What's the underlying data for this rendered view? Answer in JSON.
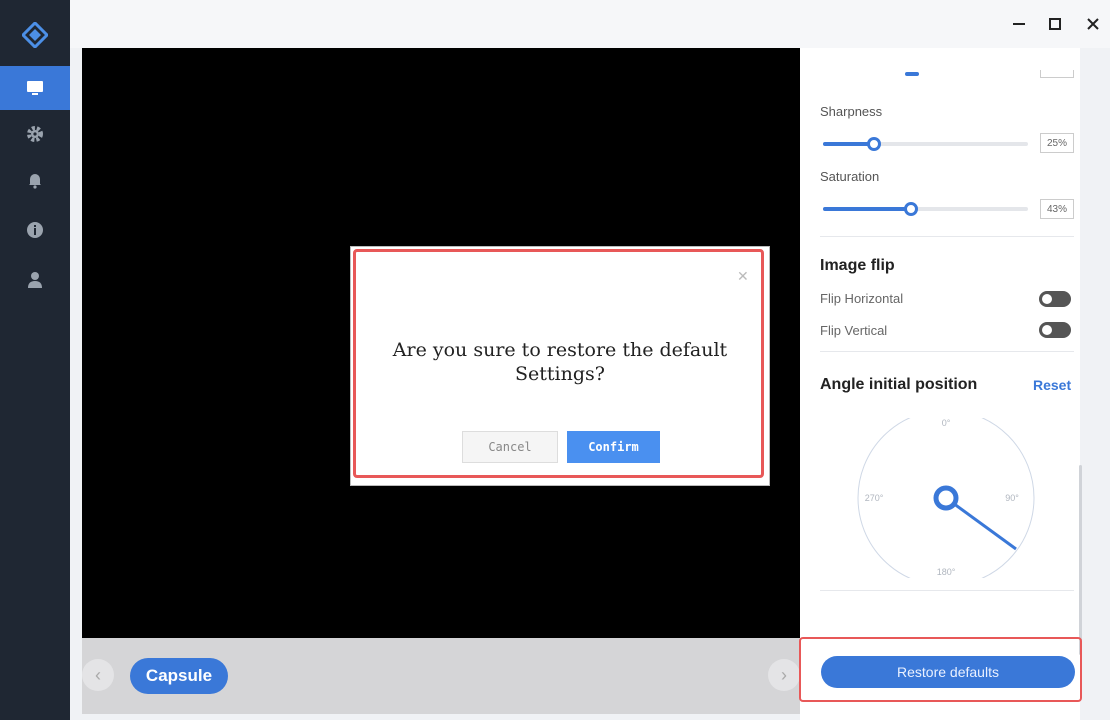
{
  "sidebar": {
    "logo_icon": "diamond-logo-icon",
    "items": [
      {
        "name": "monitor",
        "icon": "monitor-icon",
        "active": true
      },
      {
        "name": "settings",
        "icon": "gear-icon",
        "active": false
      },
      {
        "name": "notifications",
        "icon": "bell-icon",
        "active": false
      },
      {
        "name": "info",
        "icon": "info-icon",
        "active": false
      },
      {
        "name": "user",
        "icon": "user-icon",
        "active": false
      }
    ]
  },
  "window_controls": {
    "minimize": "minimize-icon",
    "maximize": "maximize-icon",
    "close": "close-icon"
  },
  "bottombar": {
    "capsule_label": "Capsule"
  },
  "panel": {
    "sliders": [
      {
        "label": "Sharpness",
        "value": 25,
        "value_text": "25%"
      },
      {
        "label": "Saturation",
        "value": 43,
        "value_text": "43%"
      }
    ],
    "image_flip": {
      "title": "Image flip",
      "horizontal_label": "Flip Horizontal",
      "vertical_label": "Flip Vertical"
    },
    "angle": {
      "title": "Angle initial position",
      "reset_label": "Reset",
      "ticks": {
        "top": "0°",
        "right": "90°",
        "bottom": "180°",
        "left": "270°"
      }
    },
    "restore_label": "Restore defaults"
  },
  "dialog": {
    "message": "Are you sure to restore the default Settings?",
    "cancel_label": "Cancel",
    "confirm_label": "Confirm"
  },
  "colors": {
    "accent": "#3a78d8",
    "highlight": "#e85858",
    "sidebar": "#1f2733"
  }
}
